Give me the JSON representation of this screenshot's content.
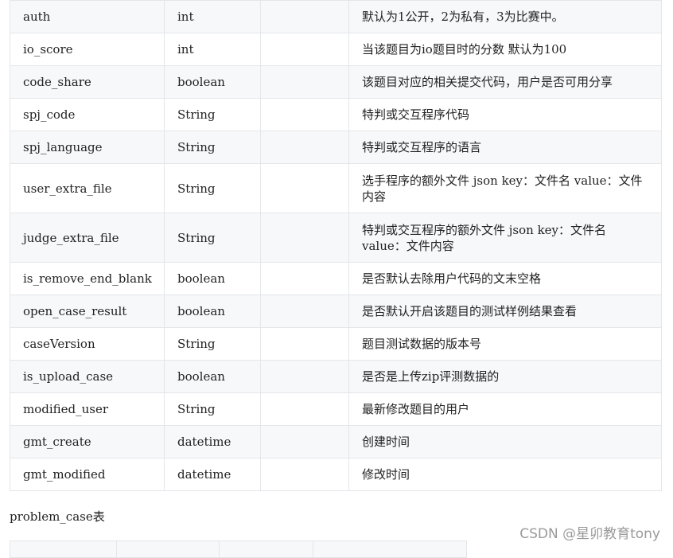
{
  "table": {
    "rows": [
      [
        "auth",
        "int",
        "",
        "默认为1公开，2为私有，3为比赛中。"
      ],
      [
        "io_score",
        "int",
        "",
        "当该题目为io题目时的分数 默认为100"
      ],
      [
        "code_share",
        "boolean",
        "",
        "该题目对应的相关提交代码，用户是否可用分享"
      ],
      [
        "spj_code",
        "String",
        "",
        "特判或交互程序代码"
      ],
      [
        "spj_language",
        "String",
        "",
        "特判或交互程序的语言"
      ],
      [
        "user_extra_file",
        "String",
        "",
        "选手程序的额外文件 json key：文件名 value：文件内容"
      ],
      [
        "judge_extra_file",
        "String",
        "",
        "特判或交互程序的额外文件 json key：文件名 value：文件内容"
      ],
      [
        "is_remove_end_blank",
        "boolean",
        "",
        "是否默认去除用户代码的文末空格"
      ],
      [
        "open_case_result",
        "boolean",
        "",
        "是否默认开启该题目的测试样例结果查看"
      ],
      [
        "caseVersion",
        "String",
        "",
        "题目测试数据的版本号"
      ],
      [
        "is_upload_case",
        "boolean",
        "",
        "是否是上传zip评测数据的"
      ],
      [
        "modified_user",
        "String",
        "",
        "最新修改题目的用户"
      ],
      [
        "gmt_create",
        "datetime",
        "",
        "创建时间"
      ],
      [
        "gmt_modified",
        "datetime",
        "",
        "修改时间"
      ]
    ]
  },
  "caption": "problem_case表",
  "watermark": "CSDN @星卯教育tony"
}
